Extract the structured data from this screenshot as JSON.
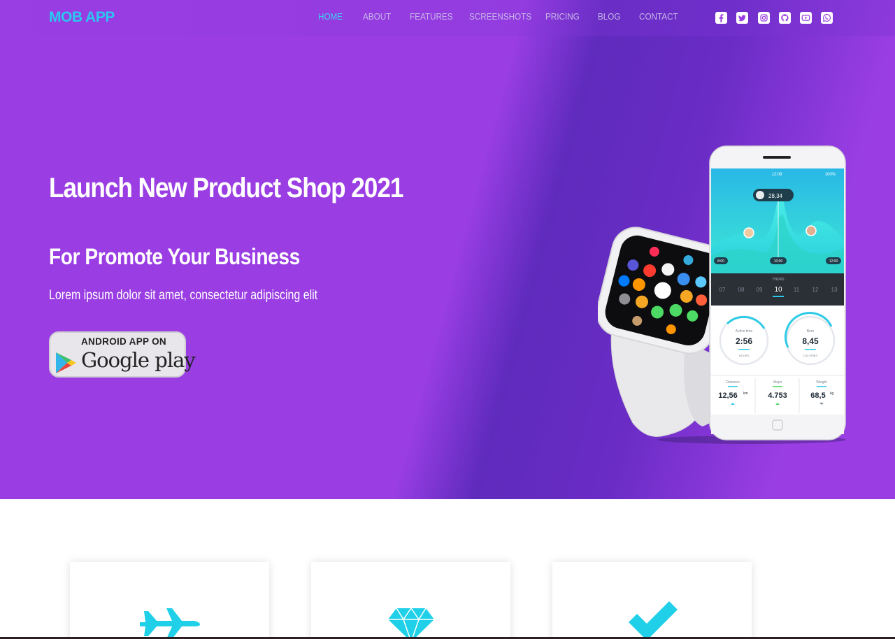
{
  "header": {
    "logo": "MOB APP",
    "nav": [
      {
        "label": "HOME",
        "active": true
      },
      {
        "label": "ABOUT",
        "active": false
      },
      {
        "label": "FEATURES",
        "active": false
      },
      {
        "label": "SCREENSHOTS",
        "active": false
      },
      {
        "label": "PRICING",
        "active": false
      },
      {
        "label": "BLOG",
        "active": false
      },
      {
        "label": "CONTACT",
        "active": false
      }
    ],
    "social": [
      "facebook-icon",
      "twitter-icon",
      "instagram-icon",
      "github-icon",
      "youtube-icon",
      "whatsapp-icon"
    ]
  },
  "hero": {
    "title": "Launch New Product Shop 2021",
    "subtitle": "For Promote Your Business",
    "lead": "Lorem ipsum dolor sit amet, consectetur adipiscing elit",
    "store_badge": {
      "top": "ANDROID APP ON",
      "bottom": "Google play"
    }
  },
  "phone": {
    "clock": "12:09",
    "battery": "100%",
    "pin_value": "28,34",
    "axis": [
      "8:00",
      "10:00",
      "12:00"
    ],
    "day_name": "THURS",
    "days": [
      "07",
      "08",
      "09",
      "10",
      "11",
      "12",
      "13"
    ],
    "stats": [
      {
        "label": "Active time",
        "value": "2:56",
        "unit": "HOURS"
      },
      {
        "label": "Burn",
        "value": "8,45",
        "unit": "CALORIES"
      }
    ],
    "metrics": [
      {
        "label": "Distance",
        "value": "12,56",
        "unit": "km"
      },
      {
        "label": "Steps",
        "value": "4.753",
        "unit": ""
      },
      {
        "label": "Weight",
        "value": "68,5",
        "unit": "kg"
      }
    ]
  },
  "colors": {
    "hero_bg": "#9a3ee3",
    "accent": "#29c8ef",
    "card_icon": "#1fd0e8"
  },
  "features": [
    {
      "icon": "jet-icon"
    },
    {
      "icon": "diamond-icon"
    },
    {
      "icon": "check-icon"
    }
  ]
}
